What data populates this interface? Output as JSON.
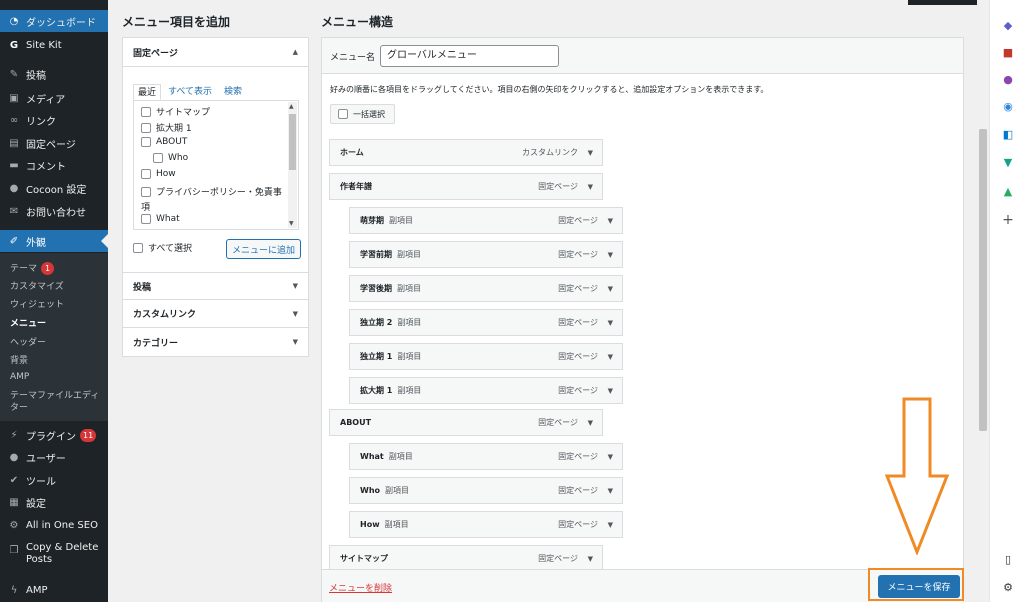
{
  "sidebar": {
    "items": [
      {
        "label": "ダッシュボード",
        "icon": "dashboard-icon"
      },
      {
        "label": "Site Kit",
        "icon": "site-kit-icon"
      },
      {
        "label": "投稿",
        "icon": "pin-icon"
      },
      {
        "label": "メディア",
        "icon": "media-icon"
      },
      {
        "label": "リンク",
        "icon": "link-icon"
      },
      {
        "label": "固定ページ",
        "icon": "page-icon"
      },
      {
        "label": "コメント",
        "icon": "comment-icon"
      },
      {
        "label": "Cocoon 設定",
        "icon": "cocoon-icon"
      },
      {
        "label": "お問い合わせ",
        "icon": "mail-icon"
      },
      {
        "label": "外観",
        "icon": "brush-icon"
      },
      {
        "label": "プラグイン",
        "icon": "plugin-icon",
        "badge": "11"
      },
      {
        "label": "ユーザー",
        "icon": "user-icon"
      },
      {
        "label": "ツール",
        "icon": "wrench-icon"
      },
      {
        "label": "設定",
        "icon": "settings-icon"
      },
      {
        "label": "All in One SEO",
        "icon": "aioseo-icon"
      },
      {
        "label": "Copy & Delete Posts",
        "icon": "copy-icon"
      },
      {
        "label": "AMP",
        "icon": "amp-icon"
      }
    ],
    "submenu": [
      {
        "label": "テーマ",
        "badge": "1"
      },
      {
        "label": "カスタマイズ"
      },
      {
        "label": "ウィジェット"
      },
      {
        "label": "メニュー",
        "current": true
      },
      {
        "label": "ヘッダー"
      },
      {
        "label": "背景"
      },
      {
        "label": "AMP"
      },
      {
        "label": "テーマファイルエディター"
      }
    ]
  },
  "add_items": {
    "heading": "メニュー項目を追加",
    "section_pages": "固定ページ",
    "tabs": [
      "最近",
      "すべて表示",
      "検索"
    ],
    "pages": [
      "サイトマップ",
      "拡大期 1",
      "ABOUT",
      "Who",
      "How",
      "プライバシーポリシー・免責事",
      "項",
      "What"
    ],
    "select_all": "すべて選択",
    "add_button": "メニューに追加",
    "section_posts": "投稿",
    "section_custom_links": "カスタムリンク",
    "section_categories": "カテゴリー"
  },
  "structure": {
    "heading": "メニュー構造",
    "name_label": "メニュー名",
    "name_value": "グローバルメニュー",
    "instructions": "好みの順番に各項目をドラッグしてください。項目の右側の矢印をクリックすると、追加設定オプションを表示できます。",
    "bulk_select": "一括選択",
    "sub_item_label": "副項目",
    "items": [
      {
        "title": "ホーム",
        "type": "カスタムリンク",
        "level": 0
      },
      {
        "title": "作者年譜",
        "type": "固定ページ",
        "level": 0
      },
      {
        "title": "萌芽期",
        "type": "固定ページ",
        "level": 1
      },
      {
        "title": "学習前期",
        "type": "固定ページ",
        "level": 1
      },
      {
        "title": "学習後期",
        "type": "固定ページ",
        "level": 1
      },
      {
        "title": "独立期 2",
        "type": "固定ページ",
        "level": 1
      },
      {
        "title": "独立期 1",
        "type": "固定ページ",
        "level": 1
      },
      {
        "title": "拡大期 1",
        "type": "固定ページ",
        "level": 1
      },
      {
        "title": "ABOUT",
        "type": "固定ページ",
        "level": 0
      },
      {
        "title": "What",
        "type": "固定ページ",
        "level": 1
      },
      {
        "title": "Who",
        "type": "固定ページ",
        "level": 1
      },
      {
        "title": "How",
        "type": "固定ページ",
        "level": 1
      },
      {
        "title": "サイトマップ",
        "type": "固定ページ",
        "level": 0
      }
    ],
    "delete_link": "メニューを削除",
    "save_button": "メニューを保存"
  },
  "colors": {
    "admin_blue": "#2271b1",
    "sidebar_bg": "#1d2327",
    "highlight_orange": "#f08a24",
    "delete_red": "#d63638"
  }
}
